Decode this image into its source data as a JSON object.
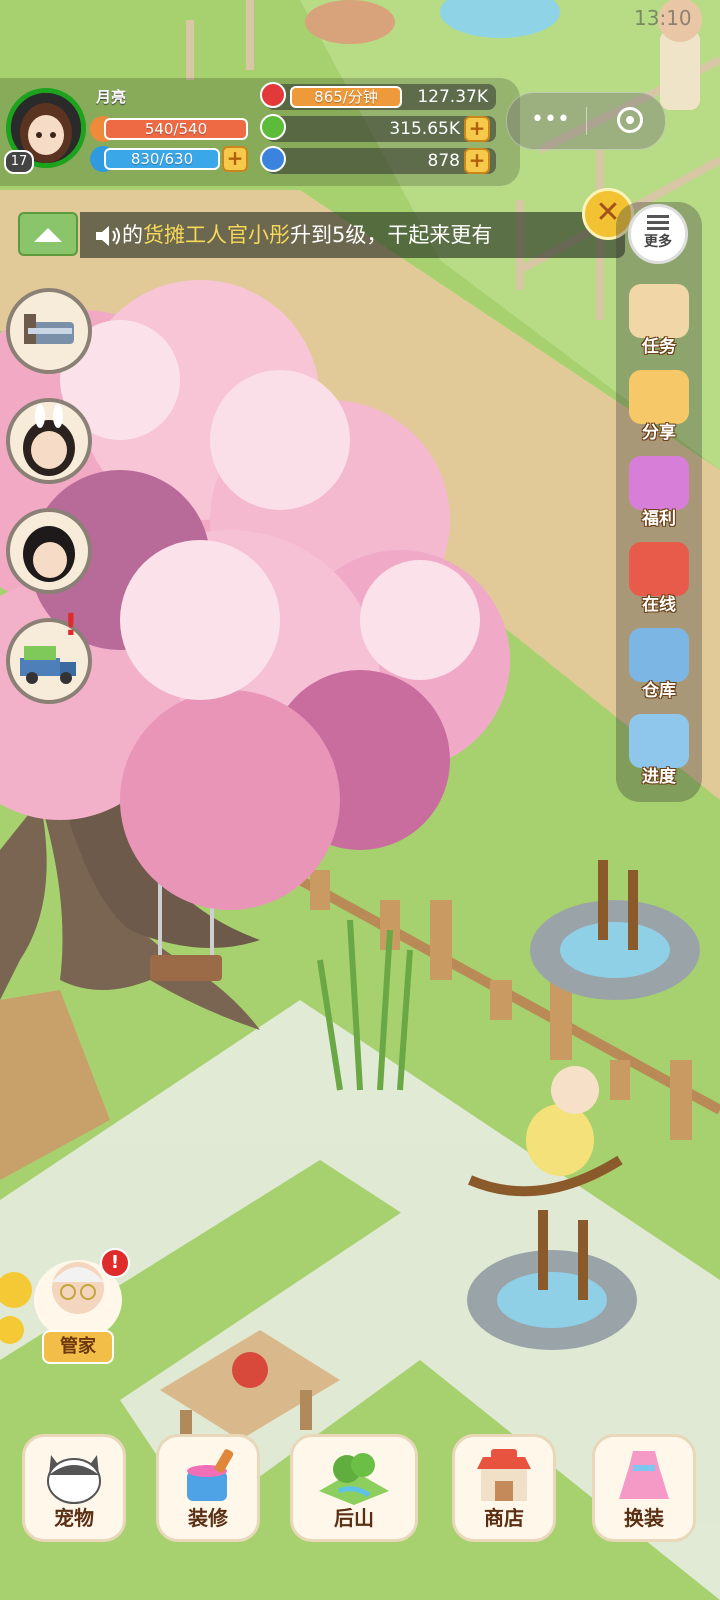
{
  "status_bar": {
    "time": "13:10"
  },
  "player": {
    "name": "月亮",
    "level": "17",
    "stamina": "540/540",
    "energy": "830/630"
  },
  "resources": {
    "hearts_rate": "865/分钟",
    "hearts_total": "127.37K",
    "cash": "315.65K",
    "gems": "878"
  },
  "ticker": {
    "prefix": "的",
    "highlight": "货摊工人官小彤",
    "rest": "升到5级，干起来更有"
  },
  "right_menu": {
    "more": "更多",
    "items": [
      "任务",
      "分享",
      "福利",
      "在线",
      "仓库",
      "进度"
    ]
  },
  "butler": {
    "label": "管家",
    "alert": "!"
  },
  "bottom_bar": [
    "宠物",
    "装修",
    "后山",
    "商店",
    "换装"
  ],
  "colors": {
    "grass": "#9fcf6b",
    "path": "#e2c998",
    "blossom": "#f4b8cf",
    "stamina_bar": "#ee6a45",
    "energy_bar": "#3aa7e8",
    "accent_gold": "#f3be47"
  }
}
